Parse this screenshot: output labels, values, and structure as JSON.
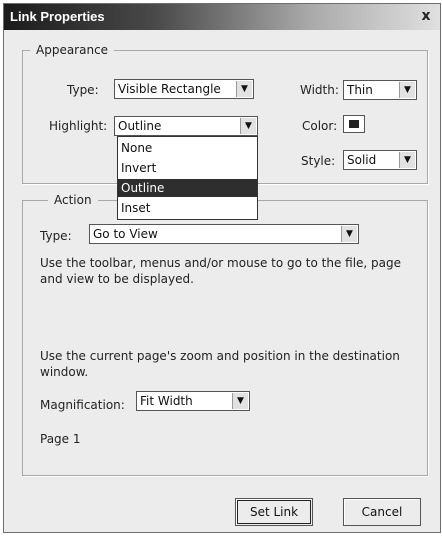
{
  "window": {
    "title": "Link Properties",
    "close_label": "x"
  },
  "appearance": {
    "legend": "Appearance",
    "type_label": "Type:",
    "type_value": "Visible Rectangle",
    "width_label": "Width:",
    "width_value": "Thin",
    "highlight_label": "Highlight:",
    "highlight_value": "Outline",
    "color_label": "Color:",
    "style_label": "Style:",
    "style_value": "Solid"
  },
  "highlight_options": [
    "None",
    "Invert",
    "Outline",
    "Inset"
  ],
  "highlight_selected_index": 2,
  "action": {
    "legend": "Action",
    "type_label": "Type:",
    "type_value": "Go to View",
    "instructions": "Use the toolbar, menus and/or mouse to go to the file, page and view to be displayed.",
    "zoom_note": "Use the current page's zoom and position in the destination window.",
    "magnification_label": "Magnification:",
    "magnification_value": "Fit Width",
    "page_text": "Page 1"
  },
  "buttons": {
    "set_link": "Set Link",
    "cancel": "Cancel"
  },
  "colors": {
    "link_color": "#222222",
    "selection": "#2e2e2e"
  }
}
